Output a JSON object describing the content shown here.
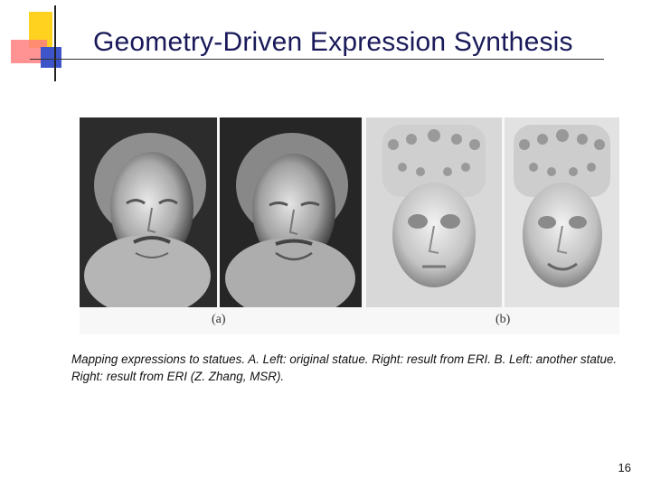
{
  "slide": {
    "title": "Geometry-Driven Expression Synthesis",
    "caption": "Mapping expressions to statues. A. Left: original statue. Right: result from ERI. B. Left: another statue. Right: result from ERI (Z. Zhang, MSR).",
    "page_number": "16"
  },
  "figure": {
    "label_a": "(a)",
    "label_b": "(b)"
  },
  "colors": {
    "title": "#1a1a5a",
    "deco_yellow": "#ffd21f",
    "deco_red": "#ff7f7f",
    "deco_blue": "#3d55c8"
  }
}
